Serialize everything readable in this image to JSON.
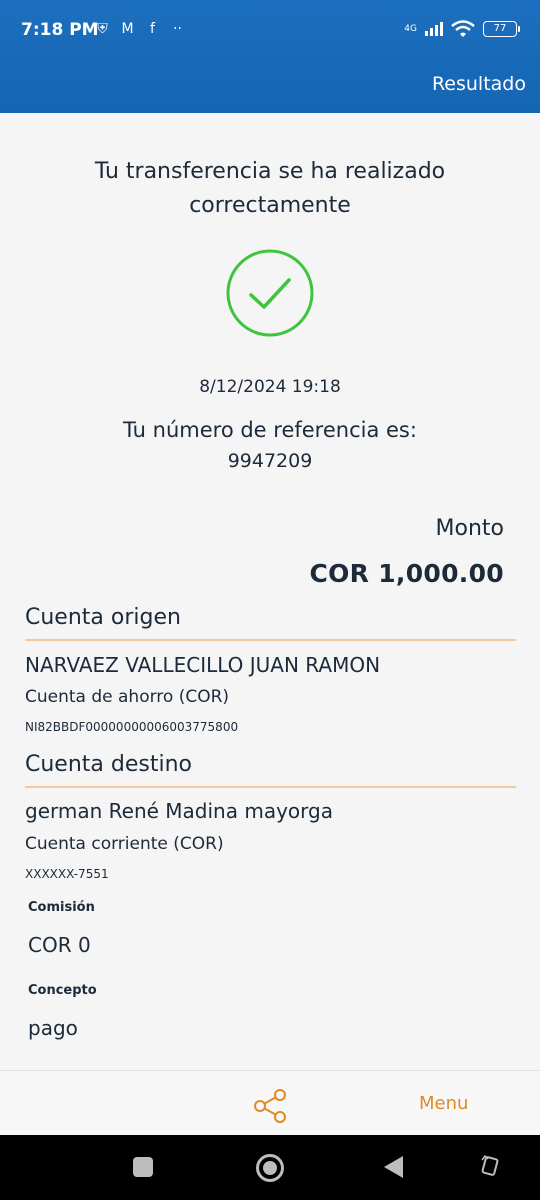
{
  "status_bar": {
    "time": "7:18 PM",
    "network_label": "4G",
    "battery": "77",
    "more_indicator": "··"
  },
  "header": {
    "title": "Resultado"
  },
  "result": {
    "message": "Tu transferencia se ha realizado correctamente",
    "date_time": "8/12/2024 19:18",
    "reference_label": "Tu número de referencia es:",
    "reference_number": "9947209",
    "amount_label": "Monto",
    "amount_value": "COR 1,000.00",
    "success_color": "#3ec43e"
  },
  "origin": {
    "title": "Cuenta origen",
    "name": "NARVAEZ VALLECILLO JUAN RAMON",
    "account_type": "Cuenta de ahorro (COR)",
    "account_number": "NI82BBDF00000000006003775800"
  },
  "destination": {
    "title": "Cuenta destino",
    "name": "german René Madina mayorga",
    "account_type": "Cuenta corriente (COR)",
    "account_number": "XXXXXX-7551"
  },
  "commission": {
    "label": "Comisión",
    "value": "COR 0"
  },
  "concept": {
    "label": "Concepto",
    "value": "pago"
  },
  "bottom_bar": {
    "share_icon": "share-icon",
    "menu_label": "Menu",
    "accent_color": "#e08a25"
  },
  "colors": {
    "header_blue": "#1466b3",
    "divider": "#f0c9a0"
  }
}
